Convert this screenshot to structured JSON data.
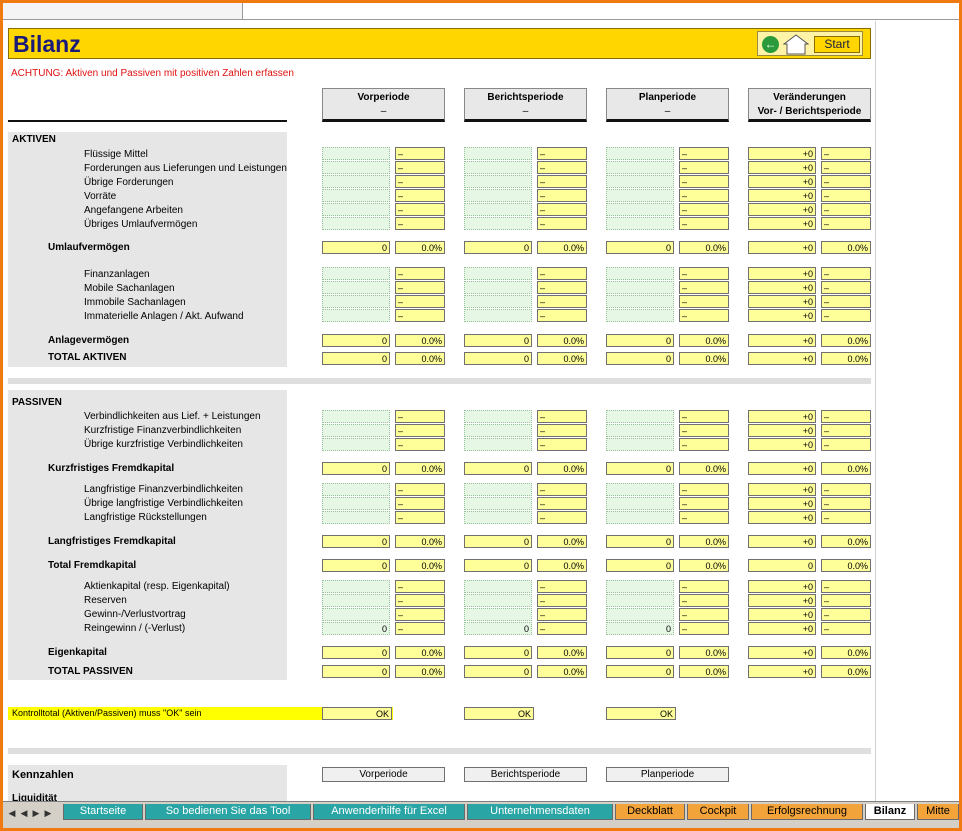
{
  "sheet": {
    "title": "Bilanz",
    "start_label": "Start",
    "back_icon": "back-arrow-icon",
    "home_icon": "home-icon",
    "warning": "ACHTUNG: Aktiven und Passiven mit positiven Zahlen erfassen"
  },
  "columns": [
    {
      "line1": "Vorperiode",
      "line2": "–"
    },
    {
      "line1": "Berichtsperiode",
      "line2": "–"
    },
    {
      "line1": "Planperiode",
      "line2": "–"
    },
    {
      "line1": "Veränderungen",
      "line2": "Vor- / Berichtsperiode"
    }
  ],
  "aktiven": {
    "heading": "AKTIVEN",
    "umlauf_items": [
      "Flüssige Mittel",
      "Forderungen aus Lieferungen und Leistungen",
      "Übrige Forderungen",
      "Vorräte",
      "Angefangene Arbeiten",
      "Übriges Umlaufvermögen"
    ],
    "umlauf_total": "Umlaufvermögen",
    "anlage_items": [
      "Finanzanlagen",
      "Mobile Sachanlagen",
      "Immobile Sachanlagen",
      "Immaterielle Anlagen / Akt. Aufwand"
    ],
    "anlage_total": "Anlagevermögen",
    "total": "TOTAL AKTIVEN"
  },
  "passiven": {
    "heading": "PASSIVEN",
    "kf_items": [
      "Verbindlichkeiten aus Lief. + Leistungen",
      "Kurzfristige Finanzverbindlichkeiten",
      "Übrige kurzfristige Verbindlichkeiten"
    ],
    "kf_total": "Kurzfristiges Fremdkapital",
    "lf_items": [
      "Langfristige Finanzverbindlichkeiten",
      "Übrige langfristige Verbindlichkeiten",
      "Langfristige Rückstellungen"
    ],
    "lf_total": "Langfristiges Fremdkapital",
    "fk_total": "Total Fremdkapital",
    "ek_items": [
      "Aktienkapital (resp. Eigenkapital)",
      "Reserven",
      "Gewinn-/Verlustvortrag",
      "Reingewinn / (-Verlust)"
    ],
    "ek_total": "Eigenkapital",
    "total": "TOTAL PASSIVEN"
  },
  "values": {
    "dash": "–",
    "zero": "0",
    "pct": "0.0%",
    "plus_zero": "+0",
    "ok": "OK"
  },
  "kontroll": "Kontrolltotal (Aktiven/Passiven) muss \"OK\" sein",
  "kennzahlen": {
    "heading": "Kennzahlen",
    "sub": "Liquidität",
    "cols": [
      "Vorperiode",
      "Berichtsperiode",
      "Planperiode"
    ]
  },
  "tabs": [
    "Startseite",
    "So bedienen Sie das Tool",
    "Anwenderhilfe für Excel",
    "Unternehmensdaten",
    "Deckblatt",
    "Cockpit",
    "Erfolgsrechnung",
    "Bilanz",
    "Mitte"
  ],
  "tab_nav_icons": [
    "first-sheet-icon",
    "prev-sheet-icon",
    "next-sheet-icon",
    "last-sheet-icon"
  ],
  "colors": {
    "title_yellow": "#ffd600",
    "input_yellow": "#ffff99",
    "input_green": "#e6f7e6",
    "warning_red": "#e01010",
    "tab_teal": "#2aa5a5",
    "tab_orange": "#f2a33a",
    "frame_orange": "#f07a10"
  }
}
